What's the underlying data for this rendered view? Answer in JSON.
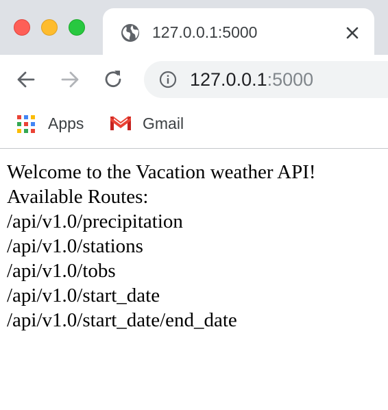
{
  "browser": {
    "tab": {
      "title": "127.0.0.1:5000",
      "favicon": "globe-icon"
    },
    "address_bar": {
      "host": "127.0.0.1",
      "port_suffix": ":5000",
      "icon": "info-icon"
    },
    "bookmarks": [
      {
        "label": "Apps",
        "icon": "apps-grid-icon"
      },
      {
        "label": "Gmail",
        "icon": "gmail-icon"
      }
    ],
    "colors": {
      "traffic_close": "#fe5f57",
      "traffic_minimize": "#febc2e",
      "traffic_maximize": "#28c840",
      "tabstrip_bg": "#dee1e6",
      "omnibox_bg": "#f1f3f4"
    }
  },
  "page": {
    "welcome": "Welcome to the Vacation weather API!",
    "routes_heading": "Available Routes:",
    "routes": [
      "/api/v1.0/precipitation",
      "/api/v1.0/stations",
      "/api/v1.0/tobs",
      "/api/v1.0/start_date",
      "/api/v1.0/start_date/end_date"
    ]
  }
}
